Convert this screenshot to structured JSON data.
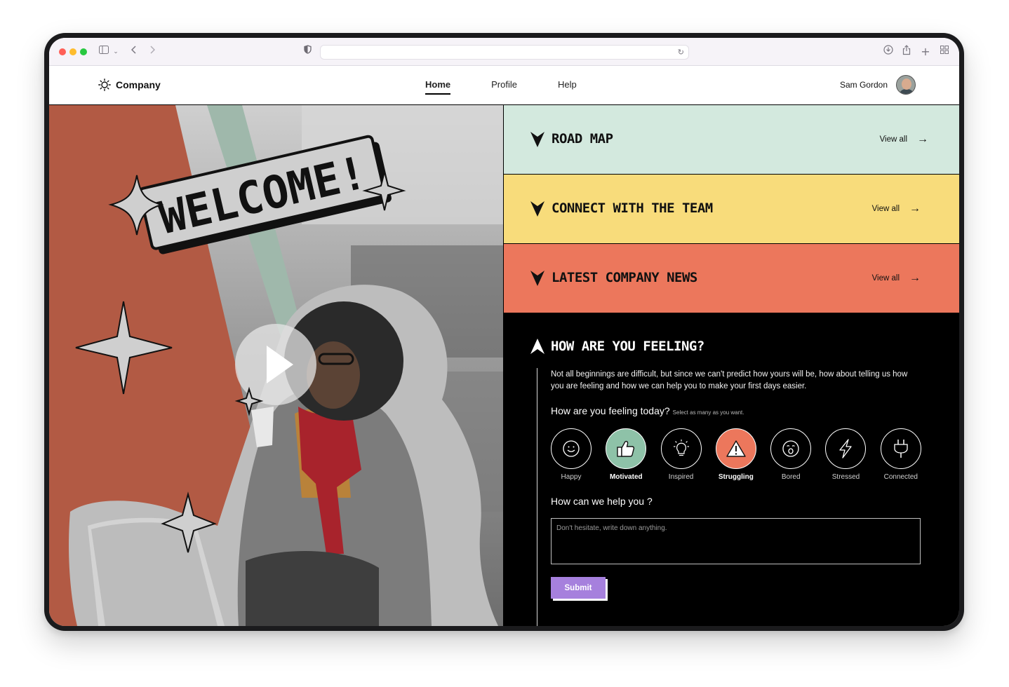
{
  "site": {
    "brand": "Company",
    "nav": [
      {
        "label": "Home",
        "active": true
      },
      {
        "label": "Profile",
        "active": false
      },
      {
        "label": "Help",
        "active": false
      }
    ],
    "user": {
      "name": "Sam Gordon"
    }
  },
  "hero": {
    "banner": "WELCOME!",
    "colors": {
      "stripe_orange": "#b25a44",
      "stripe_green": "#9fb8ab"
    }
  },
  "sections": [
    {
      "title": "ROAD MAP",
      "link": "View all",
      "color": "#d3e9de"
    },
    {
      "title": "CONNECT WITH THE TEAM",
      "link": "View all",
      "color": "#f8dc7b"
    },
    {
      "title": "LATEST COMPANY NEWS",
      "link": "View all",
      "color": "#ec775c"
    }
  ],
  "feeling": {
    "title": "HOW ARE YOU FEELING?",
    "description": "Not all beginnings are difficult, but since we can't predict how yours will be, how about telling us how you are feeling and how we can help you to make your first days easier.",
    "question": "How are you feeling today?",
    "hint": "Select as many as you want.",
    "moods": [
      {
        "label": "Happy",
        "icon": "smiley-icon",
        "selected": false
      },
      {
        "label": "Motivated",
        "icon": "thumbs-up-icon",
        "selected": true
      },
      {
        "label": "Inspired",
        "icon": "lightbulb-icon",
        "selected": false
      },
      {
        "label": "Struggling",
        "icon": "warning-icon",
        "selected": true
      },
      {
        "label": "Bored",
        "icon": "yawn-face-icon",
        "selected": false
      },
      {
        "label": "Stressed",
        "icon": "lightning-icon",
        "selected": false
      },
      {
        "label": "Connected",
        "icon": "plug-icon",
        "selected": false
      }
    ],
    "help_question": "How can we help you ?",
    "help_placeholder": "Don't hesitate, write down anything.",
    "submit_label": "Submit",
    "colors": {
      "selected_green": "#8ec2a8",
      "selected_red": "#ec775c",
      "submit": "#a680dd"
    }
  }
}
